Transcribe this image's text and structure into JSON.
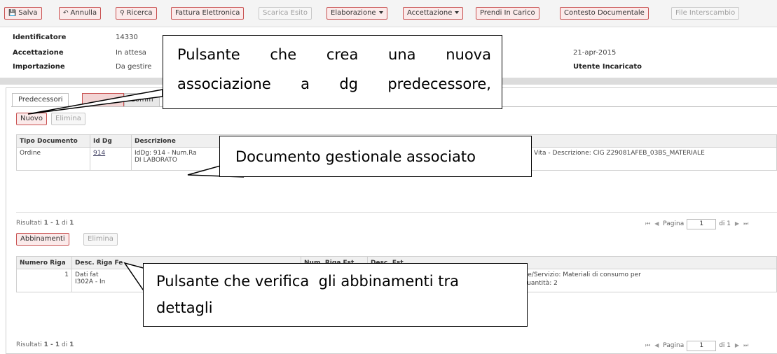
{
  "toolbar": {
    "salva": "Salva",
    "annulla": "Annulla",
    "ricerca": "Ricerca",
    "fattura_elettronica": "Fattura Elettronica",
    "scarica_esito": "Scarica Esito",
    "elaborazione": "Elaborazione",
    "accettazione": "Accettazione",
    "prendi_in_carico": "Prendi In Carico",
    "contesto_documentale": "Contesto Documentale",
    "file_interscambio": "File Interscambio"
  },
  "info": {
    "identificatore_label": "Identificatore",
    "identificatore_value": "14330",
    "accettazione_label": "Accettazione",
    "accettazione_value": "In attesa",
    "importazione_label": "Importazione",
    "importazione_value": "Da gestire",
    "date_value": "21-apr-2015",
    "utente_label": "Utente Incaricato"
  },
  "tabs": {
    "predecessori": "Predecessori",
    "tab3_partial": "Comm"
  },
  "predecessori": {
    "nuovo": "Nuovo",
    "elimina": "Elimina",
    "columns": [
      "Tipo Documento",
      "Id Dg",
      "Descrizione"
    ],
    "row": {
      "tipo": "Ordine",
      "id": "914",
      "desc_line1_left": "IdDg: 914 - Num.Ra",
      "desc_line1_right": "Vita - Descrizione: CIG Z29081AFEB_03BS_MATERIALE",
      "desc_line2": "DI LABORATO"
    },
    "risultati_prefix": "Risultati ",
    "risultati_range": "1 - 1",
    "risultati_di": " di ",
    "risultati_total": "1",
    "pagina": "Pagina",
    "page_value": "1",
    "page_of": "di 1"
  },
  "abbinamenti": {
    "abbinamenti_btn": "Abbinamenti",
    "elimina": "Elimina",
    "col_numero": "Numero Riga",
    "col_desc_fe": "Desc. Riga Fe",
    "col_num_est": "Num. Riga Est",
    "col_desc_est": "Desc. Est",
    "row_num": "1",
    "row_fe_line1": "Dati fat",
    "row_fe_line2": "I302A - In",
    "row_est_line1": "21/01/2013 - Bene/Servizio: Materiali di consumo per",
    "row_est_line2": "ntare: 116,16 - Quantità: 2",
    "risultati_prefix": "Risultati ",
    "risultati_range": "1 - 1",
    "risultati_di": " di ",
    "risultati_total": "1",
    "pagina": "Pagina",
    "page_value": "1",
    "page_of": "di 1"
  },
  "callouts": {
    "callout1_line1_words": [
      "Pulsante",
      "che",
      "crea",
      "una",
      "nuova"
    ],
    "callout1_line2_words": [
      "associazione",
      "a",
      "dg",
      "predecessore,"
    ],
    "callout2": "Documento gestionale associato",
    "callout3_line1": "Pulsante che verifica  gli abbinamenti tra",
    "callout3_line2": "dettagli"
  }
}
